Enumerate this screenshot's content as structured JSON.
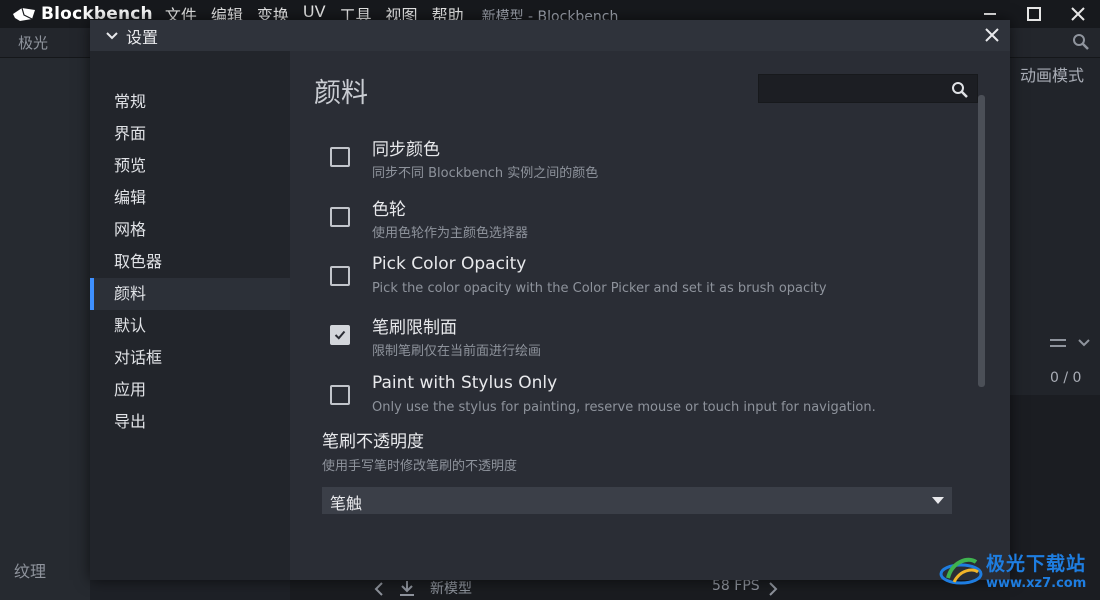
{
  "app": {
    "name": "Blockbench",
    "window_title": "新模型 - Blockbench",
    "menu": [
      "文件",
      "编辑",
      "变换",
      "UV",
      "工具",
      "视图",
      "帮助"
    ],
    "project_tab": "极光",
    "mode_label": "动画模式",
    "outliner_counter": "0 / 0",
    "texture_panel_label": "纹理",
    "status": {
      "model_name": "新模型",
      "fps": "58 FPS"
    }
  },
  "dialog": {
    "title": "设置",
    "sidebar": {
      "items": [
        "常规",
        "界面",
        "预览",
        "编辑",
        "网格",
        "取色器",
        "颜料",
        "默认",
        "对话框",
        "应用",
        "导出"
      ],
      "active_index": 6
    },
    "section_title": "颜料",
    "search": {
      "value": "",
      "placeholder": ""
    },
    "settings": [
      {
        "label": "同步颜色",
        "description": "同步不同 Blockbench 实例之间的颜色",
        "checked": false
      },
      {
        "label": "色轮",
        "description": "使用色轮作为主颜色选择器",
        "checked": false
      },
      {
        "label": "Pick Color Opacity",
        "description": "Pick the color opacity with the Color Picker and set it as brush opacity",
        "checked": false
      },
      {
        "label": "笔刷限制面",
        "description": "限制笔刷仅在当前面进行绘画",
        "checked": true
      },
      {
        "label": "Paint with Stylus Only",
        "description": "Only use the stylus for painting, reserve mouse or touch input for navigation.",
        "checked": false
      }
    ],
    "brush_opacity": {
      "label": "笔刷不透明度",
      "description": "使用手写笔时修改笔刷的不透明度",
      "selected": "笔触"
    }
  },
  "watermark": {
    "title": "极光下载站",
    "url": "www.xz7.com"
  },
  "colors": {
    "accent": "#3e90ff",
    "dialog_bg": "#2a2d35",
    "sidebar_bg": "#22252b",
    "watermark": "#1e7de0"
  }
}
